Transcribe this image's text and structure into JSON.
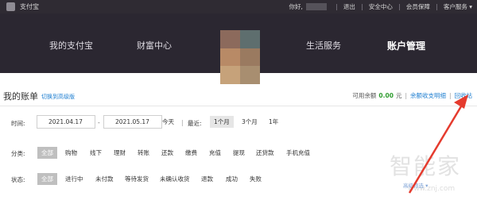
{
  "topbar": {
    "logo": "支付宝",
    "greeting": "你好,",
    "links": [
      "退出",
      "安全中心",
      "会员保障",
      "客户服务 ▾"
    ]
  },
  "nav": {
    "items": [
      "我的支付宝",
      "财富中心",
      "生活服务",
      "账户管理"
    ],
    "active": "账户管理"
  },
  "bill": {
    "title": "我的账单",
    "switch_link": "切换到高级版",
    "balance_label": "可用余额",
    "balance_amount": "0.00",
    "balance_unit": "元",
    "balance_detail": "余额收支明细",
    "recycle_bin": "回收站"
  },
  "time_filter": {
    "label": "时间:",
    "start_date": "2021.04.17",
    "end_date": "2021.05.17",
    "today": "今天",
    "recent_label": "最近:",
    "ranges": [
      "1个月",
      "3个月",
      "1年"
    ],
    "active_range": "1个月"
  },
  "category_filter": {
    "label": "分类:",
    "items": [
      "全部",
      "购物",
      "线下",
      "理财",
      "转账",
      "还款",
      "缴费",
      "充值",
      "提现",
      "还贷款",
      "手机充值"
    ],
    "active": "全部"
  },
  "status_filter": {
    "label": "状态:",
    "items": [
      "全部",
      "进行中",
      "未付款",
      "等待发货",
      "未确认收货",
      "退款",
      "成功",
      "失败"
    ],
    "active": "全部",
    "advanced": "高级筛选 ▾"
  },
  "watermark": {
    "text": "智能家",
    "url": "www.znj.com"
  },
  "colors": {
    "header_bg": "#2b2731",
    "link": "#1f7fd1",
    "amount": "#2d9c2d",
    "arrow": "#e53b2e"
  }
}
